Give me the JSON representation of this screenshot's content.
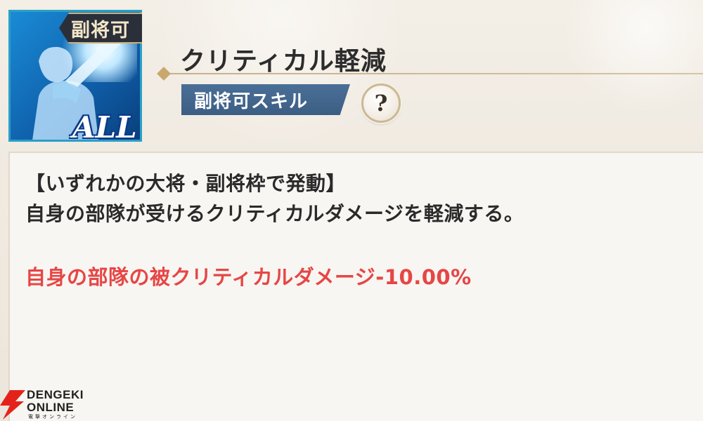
{
  "skill": {
    "badge_label": "副将可",
    "icon_label": "ALL",
    "name": "クリティカル軽減",
    "tag_label": "副将可スキル",
    "help_label": "?"
  },
  "description": {
    "line1": "【いずれかの大将・副将枠で発動】",
    "line2": "自身の部隊が受けるクリティカルダメージを軽減する。",
    "effect": "自身の部隊の被クリティカルダメージ-10.00%"
  },
  "watermark": {
    "line1": "DENGEKI",
    "line2": "ONLINE",
    "line3": "電撃オンライン"
  },
  "colors": {
    "effect_text": "#e64646",
    "tag_bg": "#4a6f97",
    "icon_bg": "#0f5ea8"
  },
  "icons": {
    "skill": "shield-sword-silhouette-icon",
    "help": "question-mark-icon",
    "brand": "dengeki-lightning-icon"
  }
}
